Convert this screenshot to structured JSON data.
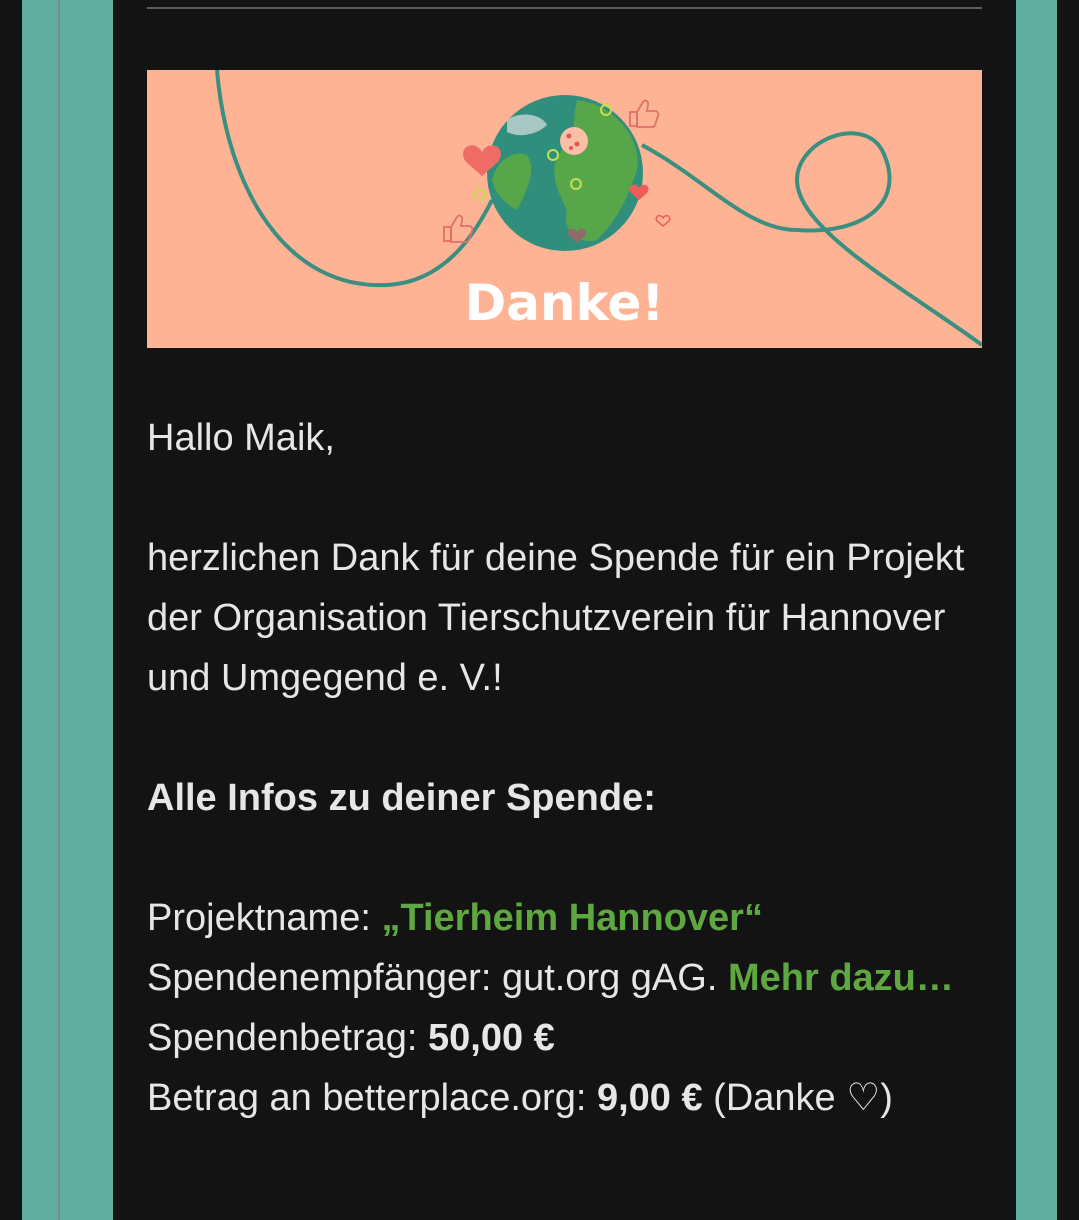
{
  "banner": {
    "title": "Danke!"
  },
  "email": {
    "greeting": "Hallo Maik,",
    "intro": "herzlichen Dank für deine Spende für ein Projekt der Organisation Tierschutzverein für Hannover und Umgegend e. V.!",
    "section_title": "Alle Infos zu deiner Spende:",
    "project_label": "Projektname: ",
    "project_value": "„Tierheim Hannover“",
    "recipient_label": "Spendenempfänger: ",
    "recipient_value": "gut.org gAG.",
    "more_link": "Mehr dazu…",
    "amount_label": "Spendenbetrag: ",
    "amount_value": "50,00 €",
    "platform_label": "Betrag an betterplace.org: ",
    "platform_value": "9,00 €",
    "platform_suffix": " (Danke ♡)"
  },
  "colors": {
    "accent_green": "#5fa841",
    "side_teal": "#5fae9f",
    "banner_peach": "#fdb394",
    "background": "#131313"
  },
  "icons": [
    "globe-icon",
    "heart-icon",
    "thumbs-up-icon",
    "location-pin-icon"
  ]
}
